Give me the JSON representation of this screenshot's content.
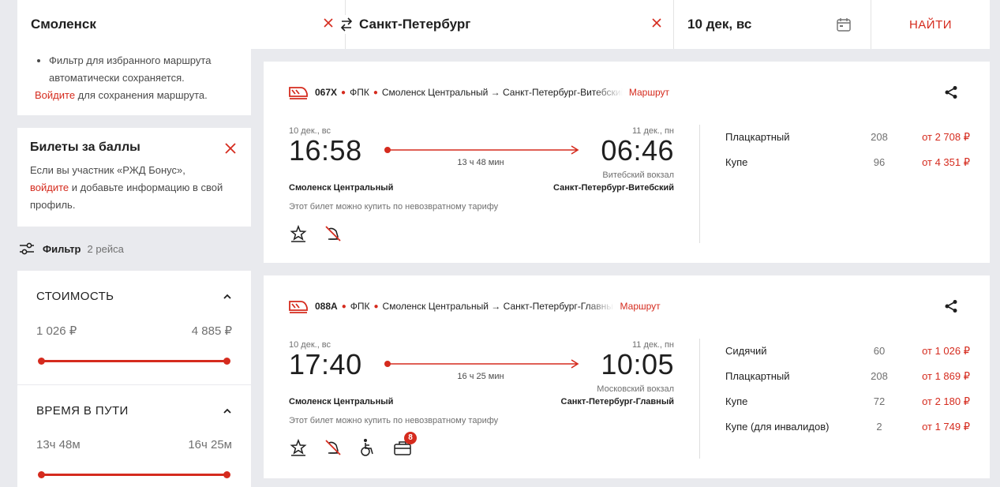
{
  "search": {
    "from": "Смоленск",
    "to": "Санкт-Петербург",
    "date": "10 дек, вс",
    "find_label": "НАЙТИ"
  },
  "route_panel": {
    "bullet": "Фильтр для избранного маршрута автоматически сохраняется.",
    "login_link": "Войдите",
    "login_rest": " для сохранения маршрута."
  },
  "bonus_panel": {
    "title": "Билеты за баллы",
    "text_1": "Если вы участник «РЖД Бонус»,",
    "link": "войдите",
    "text_2": " и добавьте информацию в свой профиль."
  },
  "filter": {
    "label": "Фильтр",
    "count": "2 рейса"
  },
  "cost_filter": {
    "title": "СТОИМОСТЬ",
    "min": "1 026 ₽",
    "max": "4 885 ₽"
  },
  "time_filter": {
    "title": "ВРЕМЯ В ПУТИ",
    "min": "13ч 48м",
    "max": "16ч 25м"
  },
  "trains": [
    {
      "number": "067Х",
      "carrier": "ФПК",
      "route": "Смоленск Центральный → Санкт-Петербург-Витебский",
      "route_link": "Маршрут",
      "dep_date": "10 дек., вс",
      "dep_time": "16:58",
      "arr_date": "11 дек., пн",
      "arr_time": "06:46",
      "duration": "13 ч 48 мин",
      "arr_station_sub": "Витебский вокзал",
      "dep_station": "Смоленск Центральный",
      "arr_station": "Санкт-Петербург-Витебский",
      "tariff": "Этот билет можно купить по невозвратному тарифу",
      "fares": [
        {
          "cls": "Плацкартный",
          "seats": "208",
          "price": "от 2 708 ₽"
        },
        {
          "cls": "Купе",
          "seats": "96",
          "price": "от 4 351 ₽"
        }
      ]
    },
    {
      "number": "088А",
      "carrier": "ФПК",
      "route": "Смоленск Центральный → Санкт-Петербург-Главный",
      "route_link": "Маршрут",
      "dep_date": "10 дек., вс",
      "dep_time": "17:40",
      "arr_date": "11 дек., пн",
      "arr_time": "10:05",
      "duration": "16 ч 25 мин",
      "arr_station_sub": "Московский вокзал",
      "dep_station": "Смоленск Центральный",
      "arr_station": "Санкт-Петербург-Главный",
      "tariff": "Этот билет можно купить по невозвратному тарифу",
      "badge": "8",
      "fares": [
        {
          "cls": "Сидячий",
          "seats": "60",
          "price": "от 1 026 ₽"
        },
        {
          "cls": "Плацкартный",
          "seats": "208",
          "price": "от 1 869 ₽"
        },
        {
          "cls": "Купе",
          "seats": "72",
          "price": "от 2 180 ₽"
        },
        {
          "cls": "Купе (для инвалидов)",
          "seats": "2",
          "price": "от 1 749 ₽"
        }
      ]
    }
  ],
  "colors": {
    "accent": "#d52b1e",
    "background": "#e9eaee"
  }
}
